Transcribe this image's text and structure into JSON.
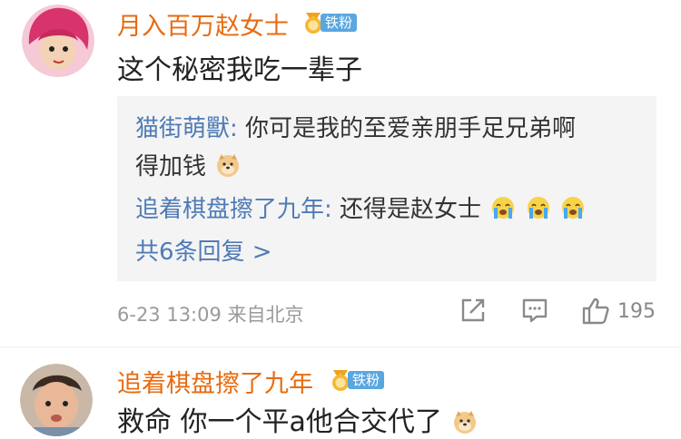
{
  "comment1": {
    "username": "月入百万赵女士",
    "badge_label": "铁粉",
    "text": "这个秘密我吃一辈子",
    "replies": [
      {
        "author": "猫街萌獸:",
        "text": "你可是我的至爱亲朋手足兄弟啊",
        "continued": "得加钱"
      },
      {
        "author": "追着棋盘擦了九年:",
        "text": "还得是赵女士"
      }
    ],
    "more_replies": "共6条回复 >",
    "meta": "6-23 13:09  来自北京",
    "like_count": "195"
  },
  "comment2": {
    "username": "追着棋盘擦了九年",
    "badge_label": "铁粉",
    "text": "救命 你一个平a他合交代了"
  },
  "colors": {
    "username": "#e86b10",
    "reply_name": "#4f7bb6",
    "badge": "#5aa7e0",
    "reply_bg": "#f4f4f4"
  }
}
